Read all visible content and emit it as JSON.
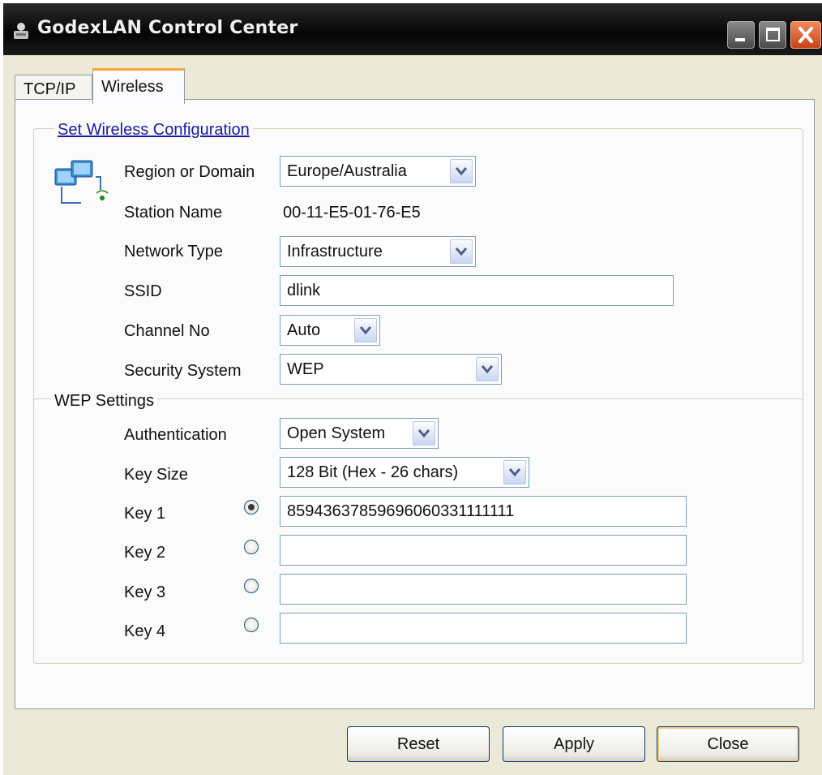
{
  "window": {
    "title": "GodexLAN Control Center"
  },
  "tabs": [
    {
      "label": "TCP/IP"
    },
    {
      "label": "Wireless"
    }
  ],
  "wireless_group": {
    "legend": "Set Wireless Configuration",
    "region": {
      "label": "Region or Domain",
      "value": "Europe/Australia"
    },
    "station": {
      "label": "Station Name",
      "value": "00-11-E5-01-76-E5"
    },
    "network_type": {
      "label": "Network Type",
      "value": "Infrastructure"
    },
    "ssid": {
      "label": "SSID",
      "value": "dlink"
    },
    "channel": {
      "label": "Channel No",
      "value": "Auto"
    },
    "security": {
      "label": "Security System",
      "value": "WEP"
    }
  },
  "wep_group": {
    "legend": "WEP Settings",
    "authentication": {
      "label": "Authentication",
      "value": "Open System"
    },
    "key_size": {
      "label": "Key Size",
      "value": "128 Bit (Hex - 26 chars)"
    },
    "keys": [
      {
        "label": "Key 1",
        "value": "85943637859696060331111111",
        "selected": true
      },
      {
        "label": "Key 2",
        "value": "",
        "selected": false
      },
      {
        "label": "Key 3",
        "value": "",
        "selected": false
      },
      {
        "label": "Key 4",
        "value": "",
        "selected": false
      }
    ]
  },
  "buttons": {
    "reset": "Reset",
    "apply": "Apply",
    "close": "Close"
  },
  "colors": {
    "titlebar": "#050505",
    "accent_tab": "#f9a436",
    "link": "#1a1aa6",
    "close_button": "#c8421c"
  }
}
